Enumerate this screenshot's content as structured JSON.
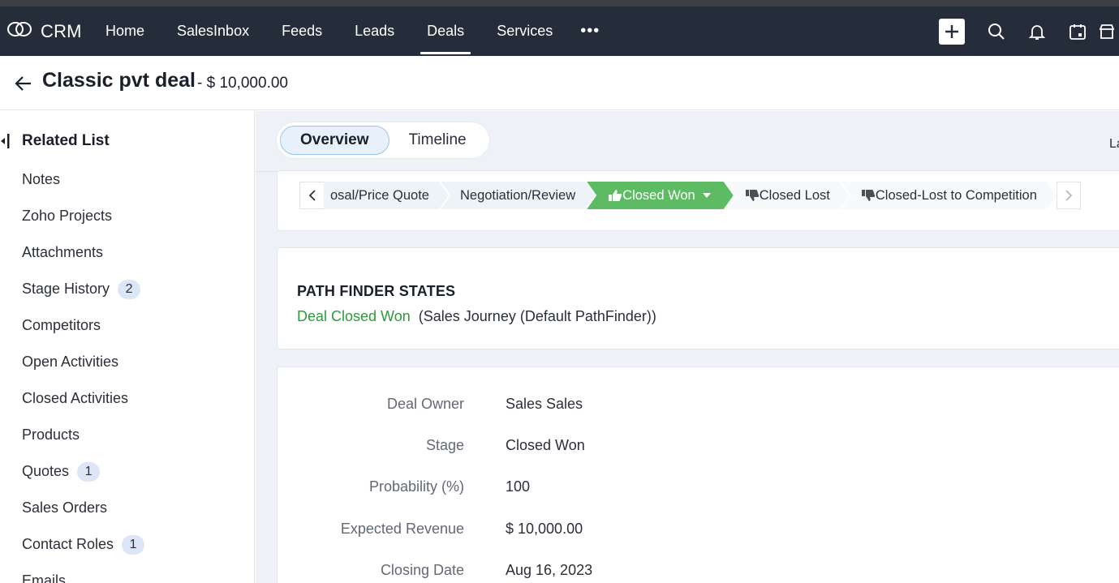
{
  "app": {
    "brand": "CRM",
    "nav": [
      {
        "label": "Home",
        "active": false
      },
      {
        "label": "SalesInbox",
        "active": false
      },
      {
        "label": "Feeds",
        "active": false
      },
      {
        "label": "Leads",
        "active": false
      },
      {
        "label": "Deals",
        "active": true
      },
      {
        "label": "Services",
        "active": false
      }
    ],
    "more": "•••",
    "icons": [
      "plus-icon",
      "search-icon",
      "bell-icon",
      "calendar-icon",
      "marketplace-icon"
    ]
  },
  "header": {
    "title": "Classic pvt deal",
    "amount": "- $ 10,000.00"
  },
  "sidebar": {
    "heading": "Related List",
    "items": [
      {
        "label": "Notes",
        "badge": ""
      },
      {
        "label": "Zoho Projects",
        "badge": ""
      },
      {
        "label": "Attachments",
        "badge": ""
      },
      {
        "label": "Stage History",
        "badge": "2"
      },
      {
        "label": "Competitors",
        "badge": ""
      },
      {
        "label": "Open Activities",
        "badge": ""
      },
      {
        "label": "Closed Activities",
        "badge": ""
      },
      {
        "label": "Products",
        "badge": ""
      },
      {
        "label": "Quotes",
        "badge": "1"
      },
      {
        "label": "Sales Orders",
        "badge": ""
      },
      {
        "label": "Contact Roles",
        "badge": "1"
      },
      {
        "label": "Emails",
        "badge": ""
      }
    ]
  },
  "tabs": [
    {
      "label": "Overview",
      "active": true
    },
    {
      "label": "Timeline",
      "active": false
    }
  ],
  "edge_text": "La",
  "stages": [
    {
      "label": "osal/Price Quote",
      "kind": "normal"
    },
    {
      "label": "Negotiation/Review",
      "kind": "normal"
    },
    {
      "label": "Closed Won",
      "kind": "won"
    },
    {
      "label": "Closed Lost",
      "kind": "lost"
    },
    {
      "label": "Closed-Lost to Competition",
      "kind": "lost"
    }
  ],
  "pathfinder": {
    "title": "PATH FINDER STATES",
    "state": "Deal Closed Won",
    "journey": "(Sales Journey (Default PathFinder))"
  },
  "details": [
    {
      "label": "Deal Owner",
      "value": "Sales Sales"
    },
    {
      "label": "Stage",
      "value": "Closed Won"
    },
    {
      "label": "Probability (%)",
      "value": "100"
    },
    {
      "label": "Expected Revenue",
      "value": "$ 10,000.00"
    },
    {
      "label": "Closing Date",
      "value": "Aug 16, 2023"
    }
  ],
  "colors": {
    "navbar": "#252c3a",
    "won": "#5dbb63",
    "pathfinder_state": "#2e9a3b",
    "badge": "#dde6f7"
  }
}
